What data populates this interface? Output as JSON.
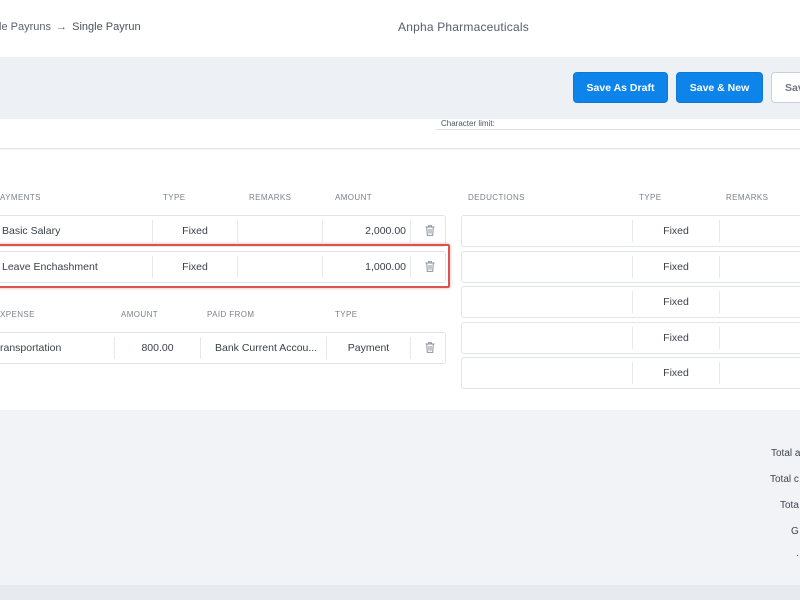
{
  "header": {
    "breadcrumb_link": "le Payruns",
    "breadcrumb_arrow": "→",
    "breadcrumb_current": "Single Payrun",
    "company": "Anpha Pharmaceuticals"
  },
  "toolbar": {
    "save_draft": "Save As Draft",
    "save_new": "Save & New",
    "save": "Sav"
  },
  "character_limit": "Character limit:",
  "payments": {
    "headers": [
      "AYMENTS",
      "TYPE",
      "REMARKS",
      "AMOUNT"
    ],
    "rows": [
      {
        "name": "Basic Salary",
        "type": "Fixed",
        "remarks": "",
        "amount": "2,000.00"
      },
      {
        "name": "Leave Enchashment",
        "type": "Fixed",
        "remarks": "",
        "amount": "1,000.00"
      }
    ]
  },
  "expenses": {
    "headers": [
      "XPENSE",
      "AMOUNT",
      "PAID FROM",
      "TYPE"
    ],
    "rows": [
      {
        "name": "ransportation",
        "amount": "800.00",
        "paid_from": "Bank Current Accou...",
        "type": "Payment"
      }
    ]
  },
  "deductions": {
    "headers": [
      "DEDUCTIONS",
      "TYPE",
      "REMARKS"
    ],
    "rows": [
      {
        "name": "",
        "type": "Fixed"
      },
      {
        "name": "",
        "type": "Fixed"
      },
      {
        "name": "",
        "type": "Fixed"
      },
      {
        "name": "",
        "type": "Fixed"
      },
      {
        "name": "",
        "type": "Fixed"
      }
    ]
  },
  "totals": {
    "t1": "Total a",
    "t2": "Total c",
    "t3": "Tota",
    "t4": "G",
    "t5": "·"
  },
  "icons": {
    "delete": "trash-icon"
  },
  "colors": {
    "primary": "#0d84ea",
    "highlight": "#d9534f"
  }
}
